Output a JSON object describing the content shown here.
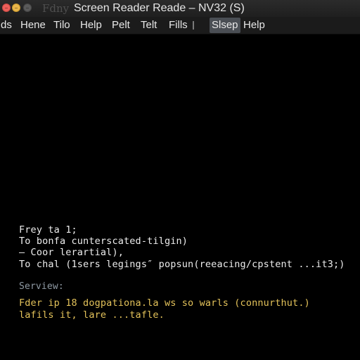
{
  "window": {
    "title_ghost": "Fdny",
    "title": "Screen Reader Reade – NV32 (S)",
    "controls": {
      "close_color": "#ec5f5a",
      "minimize_color": "#e9b64a",
      "zoom_color": "#5a5a5a"
    }
  },
  "menu": {
    "items": [
      "ds",
      "Hene",
      "Tilo",
      "Help",
      "Pelt",
      "Telt",
      "Fills",
      "Slsep",
      "Help"
    ],
    "active_index": 7,
    "active_color": "#4a4e54"
  },
  "terminal": {
    "output": [
      "Frey ta 1;",
      "To bonfa cunterscated-tilgin)",
      "– Coor lerartial),",
      "To chal (1sers legings″ popsun(reeacing/cpstent ...it3;)"
    ],
    "section_label": "Serview:",
    "notice": [
      "Fder ip 18 dogpationa.la ws so warls (connurthut.)",
      "lafils it, lare ...tafle."
    ],
    "colors": {
      "text": "#ededed",
      "label": "#8f9aa4",
      "notice": "#e3c25a"
    }
  }
}
